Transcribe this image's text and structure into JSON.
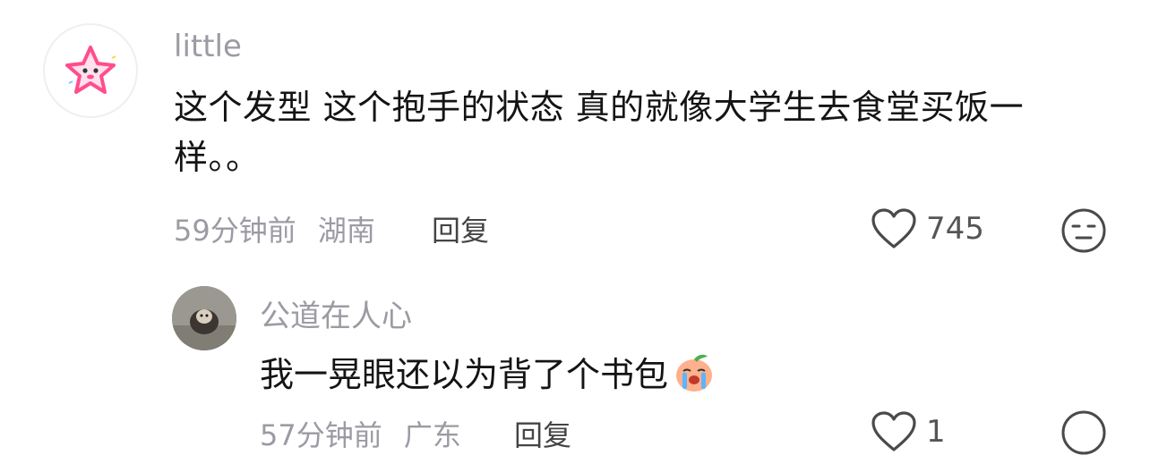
{
  "comment": {
    "username": "little",
    "text": "这个发型 这个抱手的状态 真的就像大学生去食堂买饭一样。。",
    "time": "59分钟前",
    "location": "湖南",
    "reply_label": "回复",
    "likes": "745"
  },
  "reply": {
    "username": "公道在人心",
    "text": "我一晃眼还以为背了个书包",
    "emoji": "crying-peach-emoji",
    "time": "57分钟前",
    "location": "广东",
    "reply_label": "回复",
    "likes": "1"
  },
  "colors": {
    "meta_text": "#9b9ba3",
    "body_text": "#141414",
    "avatar_star": "#ff4d8d"
  }
}
